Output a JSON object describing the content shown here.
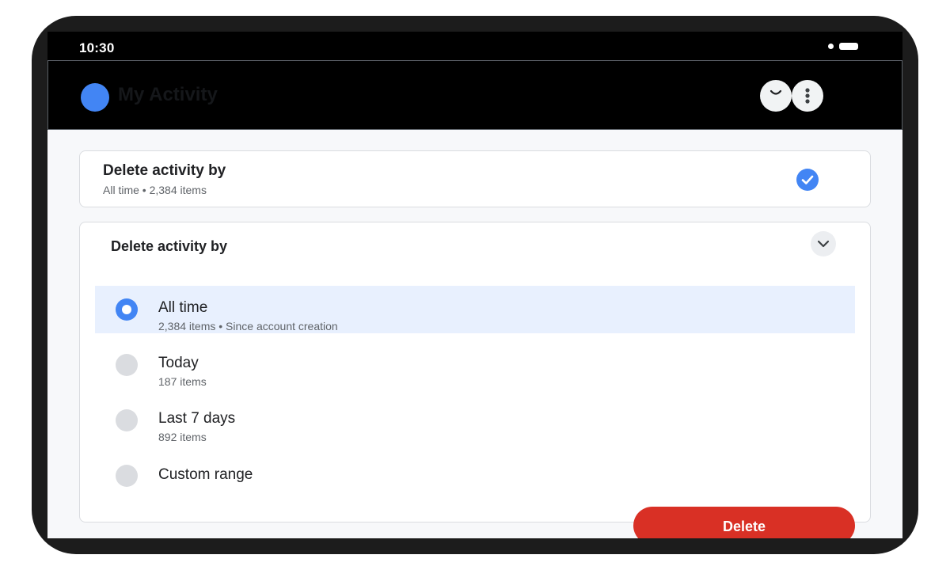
{
  "status_bar": {
    "time": "10:30"
  },
  "app_bar": {
    "title": "My Activity",
    "icons": {
      "logo": "google-logo-circle",
      "account": "account-icon",
      "more": "more-vert-icon"
    }
  },
  "summary_card": {
    "title": "Delete activity by",
    "subtitle": "All time • 2,384 items",
    "icon": "check-circle-icon"
  },
  "options_panel": {
    "title": "Delete activity by",
    "expand_icon": "chevron-down-icon",
    "options": [
      {
        "label": "All time",
        "sub": "2,384 items • Since account creation",
        "selected": true
      },
      {
        "label": "Today",
        "sub": "187 items",
        "selected": false
      },
      {
        "label": "Last 7 days",
        "sub": "892 items",
        "selected": false
      },
      {
        "label": "Custom range",
        "sub": "",
        "selected": false
      }
    ]
  },
  "actions": {
    "delete_label": "Delete"
  },
  "colors": {
    "accent": "#4285f4",
    "danger": "#d93025",
    "selected_bg": "#e8f0fe",
    "app_bar_bg": "#000000"
  }
}
